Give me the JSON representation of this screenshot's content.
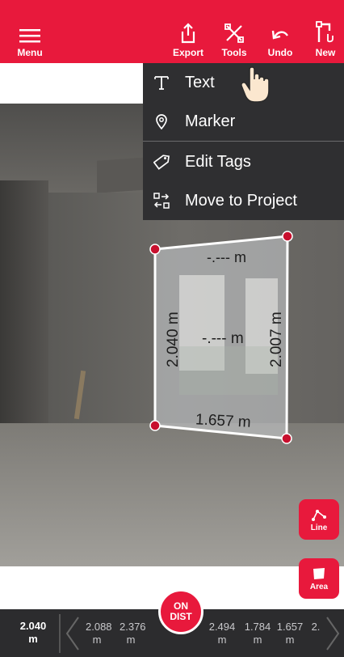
{
  "toolbar": {
    "menu": "Menu",
    "export": "Export",
    "tools": "Tools",
    "undo": "Undo",
    "new": "New"
  },
  "tools_menu": {
    "items": [
      {
        "label": "Text",
        "icon": "text-icon"
      },
      {
        "label": "Marker",
        "icon": "marker-pin-icon"
      },
      {
        "label": "Edit Tags",
        "icon": "tag-icon"
      },
      {
        "label": "Move to Project",
        "icon": "move-project-icon"
      }
    ]
  },
  "measurements": {
    "top": "-.--- m",
    "center": "-.--- m",
    "bottom": "1.657 m",
    "left": "2.040 m",
    "right": "2.007 m"
  },
  "fabs": {
    "line": "Line",
    "area": "Area"
  },
  "ondist": {
    "line1": "ON",
    "line2": "DIST"
  },
  "bottom_bar": {
    "current_value": "2.040",
    "current_unit": "m",
    "history": [
      {
        "value": "2.088",
        "unit": "m"
      },
      {
        "value": "2.376",
        "unit": "m"
      },
      {
        "value": "2.494",
        "unit": "m"
      },
      {
        "value": "1.784",
        "unit": "m"
      },
      {
        "value": "1.657",
        "unit": "m"
      },
      {
        "value": "2.",
        "unit": ""
      }
    ]
  },
  "colors": {
    "brand": "#e8193c",
    "menu_bg": "#2f2f31",
    "bottom_bg": "#2c2c2e"
  }
}
